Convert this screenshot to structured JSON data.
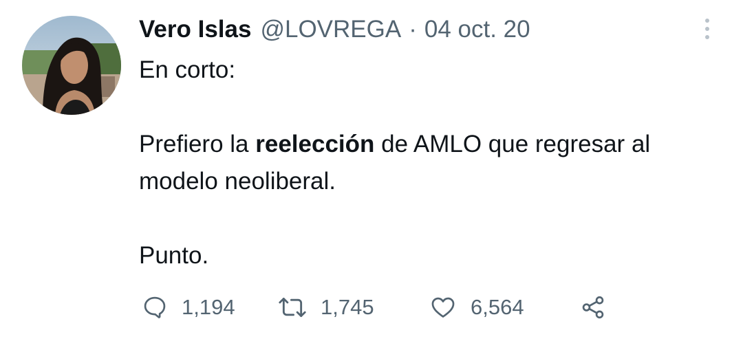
{
  "tweet": {
    "author_name": "Vero Islas",
    "handle": "@LOVREGA",
    "separator": "·",
    "date": "04 oct. 20",
    "line1": "En corto:",
    "line2_before": "Prefiero la ",
    "line2_bold": "reelección",
    "line2_after": " de AMLO que regresar al modelo neoliberal.",
    "line3": "Punto."
  },
  "actions": {
    "replies": "1,194",
    "retweets": "1,745",
    "likes": "6,564"
  },
  "icons": {
    "more": "more-vertical-icon",
    "reply": "comment-bubble-icon",
    "retweet": "retweet-arrows-icon",
    "like": "heart-icon",
    "share": "share-nodes-icon"
  },
  "colors": {
    "text": "#0f1419",
    "secondary": "#536471",
    "icon": "#536471"
  }
}
